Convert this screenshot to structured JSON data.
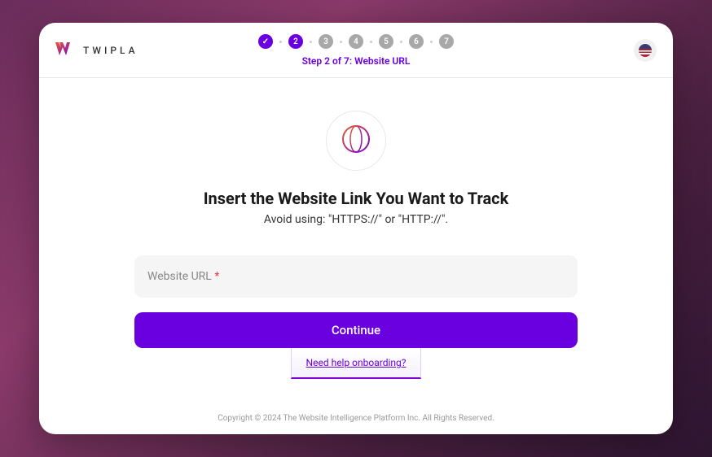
{
  "brand": {
    "name": "TWIPLA"
  },
  "stepper": {
    "current": 2,
    "total": 7,
    "label": "Step 2 of 7: Website URL",
    "steps": [
      "1",
      "2",
      "3",
      "4",
      "5",
      "6",
      "7"
    ]
  },
  "language": {
    "selected": "en-US"
  },
  "content": {
    "heading": "Insert the Website Link You Want to Track",
    "subheading": "Avoid using: \"HTTPS://\" or \"HTTP://\".",
    "input_label": "Website URL",
    "input_value": "",
    "continue_label": "Continue",
    "help_link": "Need help onboarding?"
  },
  "footer": {
    "copyright": "Copyright © 2024 The Website Intelligence Platform Inc. All Rights Reserved."
  }
}
